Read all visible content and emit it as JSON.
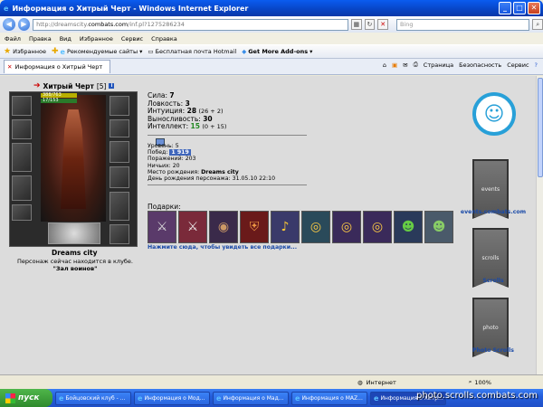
{
  "window": {
    "title": "Информация о Хитрый Черт - Windows Internet Explorer"
  },
  "address": {
    "url_prefix": "http://dreamscity.",
    "url_domain": "combats.com",
    "url_suffix": "/inf.pl?1275286234",
    "search_placeholder": "Bing"
  },
  "menu": [
    "Файл",
    "Правка",
    "Вид",
    "Избранное",
    "Сервис",
    "Справка"
  ],
  "favorites": {
    "label": "Избранное",
    "items": [
      "Рекомендуемые сайты",
      "Бесплатная почта Hotmail",
      "Get More Add-ons"
    ]
  },
  "tab": {
    "label": "Информация о Хитрый Черт"
  },
  "commands": [
    "Страница",
    "Безопасность",
    "Сервис"
  ],
  "character": {
    "name": "Хитрый Черт",
    "level": "[5]",
    "hp": "388/763",
    "mp": "17/153",
    "city": "Dreams city",
    "location_text": "Персонаж сейчас находится в клубе.",
    "location_place": "\"Зал воинов\""
  },
  "stats": [
    {
      "label": "Сила:",
      "value": "7",
      "bonus": ""
    },
    {
      "label": "Ловкость:",
      "value": "3",
      "bonus": ""
    },
    {
      "label": "Интуиция:",
      "value": "28",
      "bonus": "(26 + 2)"
    },
    {
      "label": "Выносливость:",
      "value": "30",
      "bonus": ""
    },
    {
      "label": "Интеллект:",
      "value": "15",
      "bonus": "(0 + 15)"
    }
  ],
  "info": {
    "level_label": "Уровень:",
    "level": "5",
    "wins_label": "Побед:",
    "wins": "1 919",
    "losses_label": "Поражений:",
    "losses": "203",
    "draws_label": "Ничьих:",
    "draws": "20",
    "birthplace_label": "Место рождения:",
    "birthplace": "Dreams city",
    "birthday_label": "День рождения персонажа:",
    "birthday": "31.05.10 22:10"
  },
  "gifts": {
    "title": "Подарки:",
    "link": "Нажмите сюда, чтобы увидеть все подарки..."
  },
  "sidebar": {
    "events": "events.combats.com",
    "scrolls": "Scrolls",
    "photo": "Photo Scrolls",
    "banner_events": "events",
    "banner_scrolls": "scrolls",
    "banner_photo": "photo"
  },
  "status": {
    "zone": "Интернет",
    "zoom": "100%"
  },
  "taskbar": {
    "start": "пуск",
    "tasks": [
      "Бойцовский клуб - ...",
      "Информация о Мод...",
      "Информация о Мад...",
      "Информация о MAZ...",
      "Информация о Хитр..."
    ]
  },
  "watermark": "photo.scrolls.combats.com"
}
